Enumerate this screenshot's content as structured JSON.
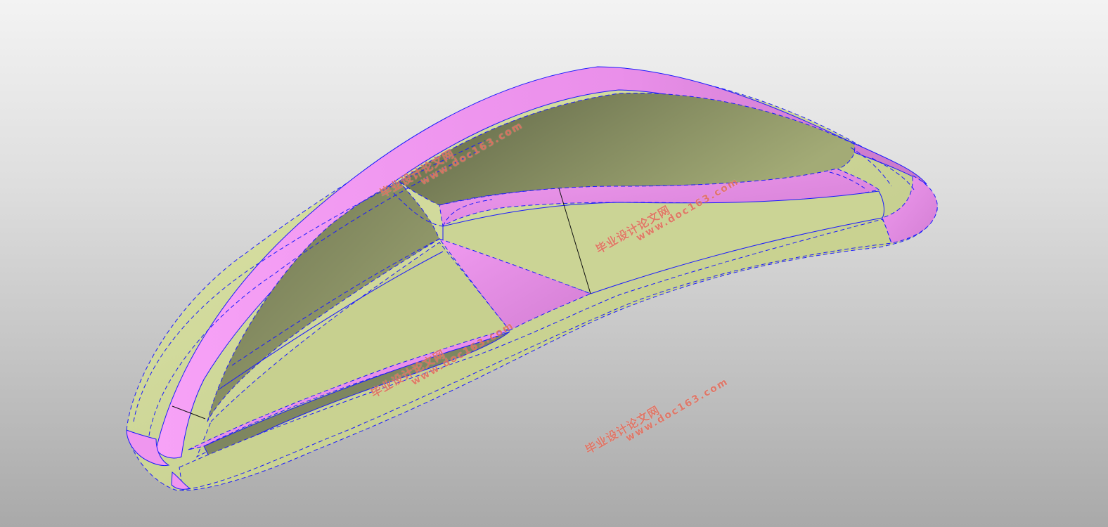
{
  "viewport": {
    "background_top": "#f3f3f3",
    "background_bottom": "#a9a9a9"
  },
  "model": {
    "name": "mouse-shell-3d-model",
    "surface_color": "#ccd596",
    "surface_shadow_color": "#8f9868",
    "fillet_color": "#ee90ee",
    "edge_color": "#1a1aff"
  },
  "watermarks": [
    {
      "cn": "毕业设计论文网",
      "url": "www.doc163.com"
    },
    {
      "cn": "毕业设计论文网",
      "url": "www.doc163.com"
    },
    {
      "cn": "毕业设计论文网",
      "url": "www.doc163.com"
    },
    {
      "cn": "毕业设计论文网",
      "url": "www.doc163.com"
    }
  ]
}
